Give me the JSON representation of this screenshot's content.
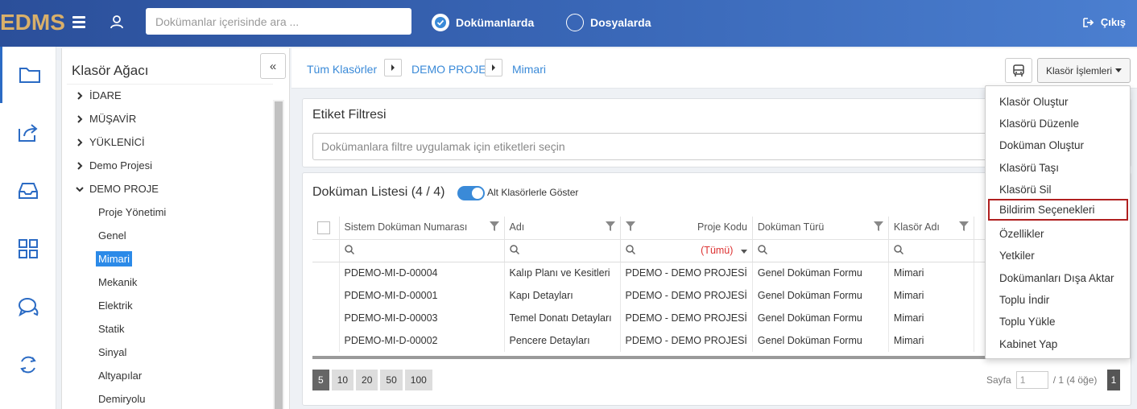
{
  "topbar": {
    "logo": "EDMS",
    "search_placeholder": "Dokümanlar içerisinde ara ...",
    "radio_documents": "Dokümanlarda",
    "radio_folders": "Dosyalarda",
    "logout_label": "Çıkış"
  },
  "tree": {
    "title": "Klasör Ağacı",
    "collapse_label": "«",
    "items": [
      {
        "label": "İDARE"
      },
      {
        "label": "MÜŞAVİR"
      },
      {
        "label": "YÜKLENİCİ"
      },
      {
        "label": "Demo Projesi"
      },
      {
        "label": "DEMO PROJE"
      },
      {
        "label": "Proje Yönetimi"
      },
      {
        "label": "Genel"
      },
      {
        "label": "Mimari"
      },
      {
        "label": "Mekanik"
      },
      {
        "label": "Elektrik"
      },
      {
        "label": "Statik"
      },
      {
        "label": "Sinyal"
      },
      {
        "label": "Altyapılar"
      },
      {
        "label": "Demiryolu"
      }
    ],
    "selected": "Mimari"
  },
  "breadcrumb": {
    "items": [
      "Tüm Klasörler",
      "DEMO PROJE",
      "Mimari"
    ]
  },
  "toolbar": {
    "folder_ops_label": "Klasör İşlemleri"
  },
  "tag_filter": {
    "title": "Etiket Filtresi",
    "placeholder": "Dokümanlara filtre uygulamak için etiketleri seçin"
  },
  "doc_list": {
    "title": "Doküman Listesi (4 / 4)",
    "toggle_label": "Alt Klasörlerle Göster",
    "columns": [
      "Sistem Doküman Numarası",
      "Adı",
      "Proje Kodu",
      "Doküman Türü",
      "Klasör Adı"
    ],
    "project_filter": "(Tümü)",
    "rows": [
      {
        "no": "PDEMO-MI-D-00004",
        "name": "Kalıp Planı ve Kesitleri",
        "project": "PDEMO - DEMO PROJESİ",
        "type": "Genel Doküman Formu",
        "folder": "Mimari"
      },
      {
        "no": "PDEMO-MI-D-00001",
        "name": "Kapı Detayları",
        "project": "PDEMO - DEMO PROJESİ",
        "type": "Genel Doküman Formu",
        "folder": "Mimari"
      },
      {
        "no": "PDEMO-MI-D-00003",
        "name": "Temel Donatı Detayları",
        "project": "PDEMO - DEMO PROJESİ",
        "type": "Genel Doküman Formu",
        "folder": "Mimari"
      },
      {
        "no": "PDEMO-MI-D-00002",
        "name": "Pencere Detayları",
        "project": "PDEMO - DEMO PROJESİ",
        "type": "Genel Doküman Formu",
        "folder": "Mimari"
      }
    ],
    "page_sizes": [
      "5",
      "10",
      "20",
      "50",
      "100"
    ],
    "active_page_size": "5",
    "page_label": "Sayfa",
    "page_value": "1",
    "page_total": "/ 1 (4 öğe)",
    "current_page": "1"
  },
  "menu": {
    "items": [
      "Klasör Oluştur",
      "Klasörü Düzenle",
      "Doküman Oluştur",
      "Klasörü Taşı",
      "Klasörü Sil",
      "Bildirim Seçenekleri",
      "Özellikler",
      "Yetkiler",
      "Dokümanları Dışa Aktar",
      "Toplu İndir",
      "Toplu Yükle",
      "Kabinet Yap"
    ],
    "highlighted": "Bildirim Seçenekleri"
  },
  "colors": {
    "topbar": "#3a68b8",
    "accent": "#2b8ae8",
    "link": "#3a8ad8",
    "highlight_border": "#b02020",
    "logo": "#d9b06a"
  }
}
